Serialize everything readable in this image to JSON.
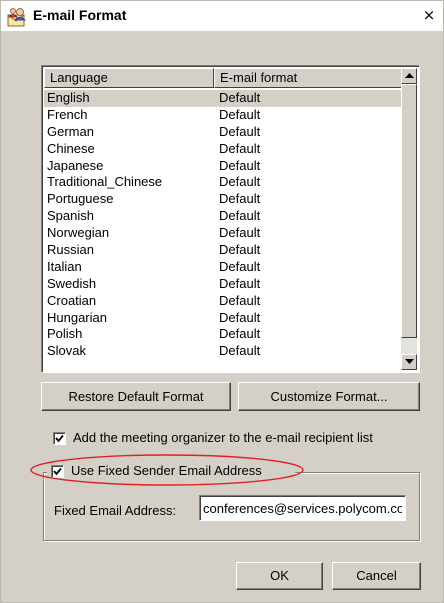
{
  "window": {
    "title": "E-mail Format",
    "close_glyph": "×"
  },
  "list": {
    "columns": [
      "Language",
      "E-mail format"
    ],
    "rows": [
      {
        "language": "English",
        "format": "Default",
        "selected": true
      },
      {
        "language": "French",
        "format": "Default"
      },
      {
        "language": "German",
        "format": "Default"
      },
      {
        "language": "Chinese",
        "format": "Default"
      },
      {
        "language": "Japanese",
        "format": "Default"
      },
      {
        "language": "Traditional_Chinese",
        "format": "Default"
      },
      {
        "language": "Portuguese",
        "format": "Default"
      },
      {
        "language": "Spanish",
        "format": "Default"
      },
      {
        "language": "Norwegian",
        "format": "Default"
      },
      {
        "language": "Russian",
        "format": "Default"
      },
      {
        "language": "Italian",
        "format": "Default"
      },
      {
        "language": "Swedish",
        "format": "Default"
      },
      {
        "language": "Croatian",
        "format": "Default"
      },
      {
        "language": "Hungarian",
        "format": "Default"
      },
      {
        "language": "Polish",
        "format": "Default"
      },
      {
        "language": "Slovak",
        "format": "Default"
      }
    ]
  },
  "buttons": {
    "restore_label": "Restore Default Format",
    "customize_label": "Customize Format...",
    "ok_label": "OK",
    "cancel_label": "Cancel"
  },
  "options": {
    "add_organizer_label": "Add the meeting organizer to the e-mail recipient list",
    "add_organizer_checked": true,
    "fixed_sender_label": "Use Fixed Sender Email Address",
    "fixed_sender_checked": true
  },
  "fixed_address": {
    "label": "Fixed Email Address:",
    "value": "conferences@services.polycom.com"
  },
  "colors": {
    "dialog_bg": "#d4d0c8",
    "highlight_ellipse": "#e02020"
  },
  "icons": {
    "title": "mail-user-icon",
    "scroll_up": "arrow-up-icon",
    "scroll_down": "arrow-down-icon",
    "check": "checkmark-icon"
  }
}
